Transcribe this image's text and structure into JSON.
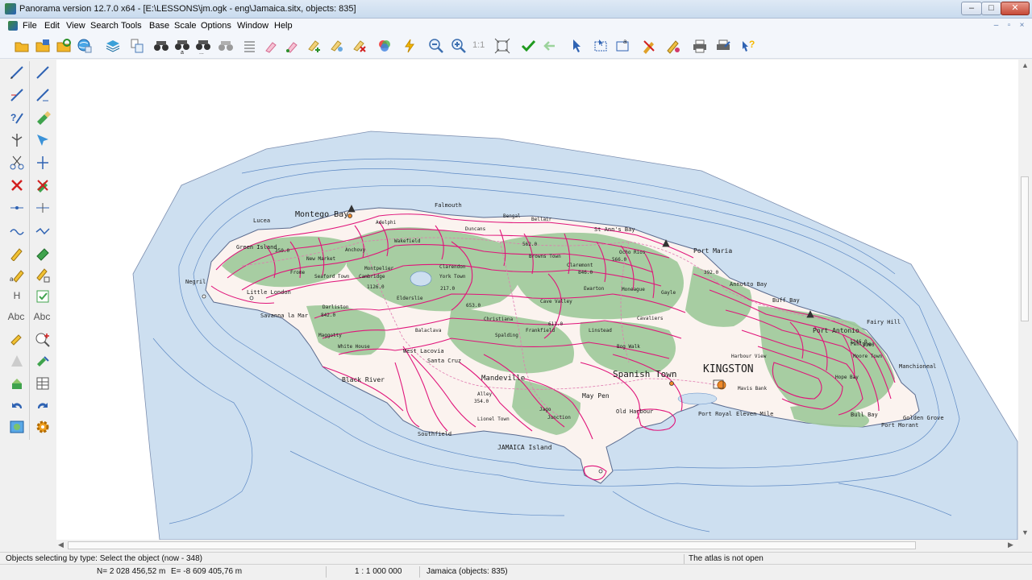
{
  "window": {
    "title": "Panorama version 12.7.0 x64 - [E:\\LESSONS\\jm.ogk - eng\\Jamaica.sitx, objects: 835]",
    "controls": {
      "minimize": "–",
      "maximize": "□",
      "close": "✕"
    }
  },
  "menu": {
    "items": [
      "File",
      "Edit",
      "View",
      "Search",
      "Tools",
      "Base",
      "Scale",
      "Options",
      "Window",
      "Help"
    ],
    "mdi": {
      "minimize": "–",
      "restore": "▫",
      "close": "×"
    }
  },
  "toolbar": {
    "scale_one_to_one": "1:1",
    "buttons": [
      "open-folder-icon",
      "save-icon",
      "refresh-icon",
      "globe-icon",
      "layers-icon",
      "document-tree-icon",
      "binoculars-icon",
      "binoculars-a-icon",
      "binoculars-dots-icon",
      "binoculars-gray-icon",
      "list-icon",
      "pin-icon",
      "pin-point-icon",
      "pin-plus-icon",
      "pin-select-icon",
      "pin-delete-icon",
      "colors-icon",
      "lightning-icon",
      "zoom-out-icon",
      "zoom-in-icon",
      "zoom-actual-icon",
      "zoom-fit-icon",
      "checkmark-icon",
      "arrow-green-icon",
      "pointer-icon",
      "frame-select-icon",
      "text-select-icon",
      "edit-tools-icon",
      "pencil-pin-icon",
      "printer-icon",
      "printer-setup-icon",
      "help-pointer-icon"
    ]
  },
  "left_tools": {
    "text_labels": {
      "h": "H",
      "abc1": "Abc",
      "abc2": "Abc"
    }
  },
  "map": {
    "labels": {
      "montego_bay": "Montego Bay",
      "falmouth": "Falmouth",
      "lucea": "Lucea",
      "negril": "Negril",
      "green_island": "Green Island",
      "little_london": "Little London",
      "savanna": "Savanna la Mar",
      "st_anns_bay": "St Ann's Bay",
      "port_maria": "Port Maria",
      "annotto_bay": "Annotto Bay",
      "buff_bay": "Buff Bay",
      "port_antonio": "Port Antonio",
      "fairy_hill": "Fairy Hill",
      "manchioneal": "Manchioneal",
      "golden_grove": "Golden Grove",
      "port_morant": "Port Morant",
      "kingston": "KINGSTON",
      "spanish_town": "Spanish Town",
      "may_pen": "May Pen",
      "mandeville": "Mandeville",
      "black_river": "Black River",
      "santa_cruz": "Santa Cruz",
      "west_lacovia": "West Lacovia",
      "southfield": "Southfield",
      "jamaica_island": "JAMAICA Island",
      "old_harbour": "Old Harbour",
      "port_royal": "Port Royal",
      "eleven_mile": "Eleven Mile",
      "bull_bay": "Bull Bay",
      "ocho_rios": "Ocho Rios",
      "brown_town": "Browns Town",
      "ewarton": "Ewarton",
      "linstead": "Linstead",
      "bog_walk": "Bog Walk",
      "frankfield": "Frankfield",
      "christiana": "Christiana",
      "spalding": "Spalding",
      "balaclava": "Balaclava",
      "montpelier": "Montpelier",
      "duncans": "Duncans",
      "bengal": "Bengal",
      "bellair": "Bellair",
      "claremont": "Claremont",
      "moneague": "Moneague",
      "gayle": "Gayle",
      "cave_valley": "Cave Valley",
      "darliston": "Darliston",
      "whitehouse": "White House",
      "cambridge": "Cambridge",
      "adelphi": "Adelphi",
      "wakefield": "Wakefield",
      "york_town": "York Town",
      "alley": "Alley",
      "lionel_town": "Lionel Town",
      "jago": "Jago",
      "junction": "Junction",
      "new_market": "New Market",
      "harbour_view": "Harbour View",
      "cavaliers": "Cavaliers",
      "mavis_bank": "Mavis Bank",
      "penlyne": "Penlyne",
      "hope_bay": "Hope Bay",
      "moore_town": "Moore Town",
      "clarendon": "Clarendon",
      "elderslie": "Elderslie",
      "maggotty": "Maggotty",
      "frome": "Frome",
      "seaford_town": "Seaford Town",
      "anchovy": "Anchovy",
      "elevation_1": "350.0",
      "elevation_2": "217.0",
      "elevation_3": "562.0",
      "elevation_4": "653.0",
      "elevation_5": "846.0",
      "elevation_6": "566.0",
      "elevation_7": "392.0",
      "elevation_8": "1246.0",
      "elevation_9": "842.0",
      "elevation_10": "354.0",
      "elevation_11": "611.0",
      "elevation_12": "1126.0",
      "elevation_13": "3390"
    }
  },
  "status": {
    "mode": "Objects selecting by type: Select the object (now - 348)",
    "atlas": "The atlas is not open",
    "northing": "N= 2 028 456,52 m",
    "easting": "E= -8 609 405,76 m",
    "scale": "1 : 1 000 000",
    "layer": "Jamaica  (objects: 835)"
  },
  "colors": {
    "sea": "#cddff0",
    "sea_deep": "#c1d6ec",
    "land": "#fbf3ef",
    "forest": "#9fc99a",
    "contour": "#e0147a",
    "isobath": "#5d89c4",
    "coast": "#5a6b8f"
  }
}
